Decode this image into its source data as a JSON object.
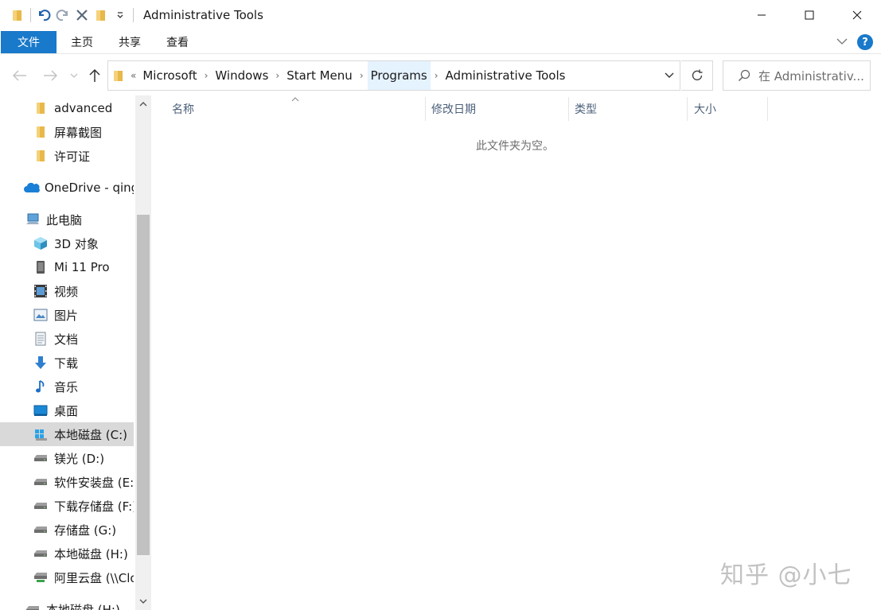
{
  "window": {
    "title": "Administrative Tools",
    "controls": [
      "minimize",
      "maximize",
      "close"
    ]
  },
  "ribbon": {
    "file_tab": "文件",
    "tabs": [
      "主页",
      "共享",
      "查看"
    ],
    "help": "?"
  },
  "address_bar": {
    "overflow": "«",
    "crumbs": [
      "Microsoft",
      "Windows",
      "Start Menu",
      "Programs",
      "Administrative Tools"
    ]
  },
  "search": {
    "placeholder": "在 Administrativ..."
  },
  "sidebar": {
    "items": [
      {
        "label": "advanced",
        "icon": "folder-icon"
      },
      {
        "label": "屏幕截图",
        "icon": "folder-icon"
      },
      {
        "label": "许可证",
        "icon": "folder-icon"
      },
      {
        "label": "OneDrive - qing",
        "icon": "onedrive-icon"
      },
      {
        "label": "此电脑",
        "icon": "this-pc-icon"
      },
      {
        "label": "3D 对象",
        "icon": "3d-objects-icon"
      },
      {
        "label": "Mi 11 Pro",
        "icon": "phone-icon"
      },
      {
        "label": "视频",
        "icon": "video-icon"
      },
      {
        "label": "图片",
        "icon": "pictures-icon"
      },
      {
        "label": "文档",
        "icon": "documents-icon"
      },
      {
        "label": "下载",
        "icon": "downloads-icon"
      },
      {
        "label": "音乐",
        "icon": "music-icon"
      },
      {
        "label": "桌面",
        "icon": "desktop-icon"
      },
      {
        "label": "本地磁盘 (C:)",
        "icon": "windows-drive-icon"
      },
      {
        "label": "镁光 (D:)",
        "icon": "drive-icon"
      },
      {
        "label": "软件安装盘 (E:)",
        "icon": "drive-icon"
      },
      {
        "label": "下载存储盘 (F:)",
        "icon": "drive-icon"
      },
      {
        "label": "存储盘 (G:)",
        "icon": "drive-icon"
      },
      {
        "label": "本地磁盘 (H:)",
        "icon": "drive-icon"
      },
      {
        "label": "阿里云盘 (\\\\Clo",
        "icon": "network-drive-icon"
      },
      {
        "label": "本地磁盘 (H:)",
        "icon": "drive-icon"
      }
    ],
    "selected_index": 13
  },
  "columns": [
    "名称",
    "修改日期",
    "类型",
    "大小"
  ],
  "empty_message": "此文件夹为空。",
  "watermark": "知乎 @小七"
}
